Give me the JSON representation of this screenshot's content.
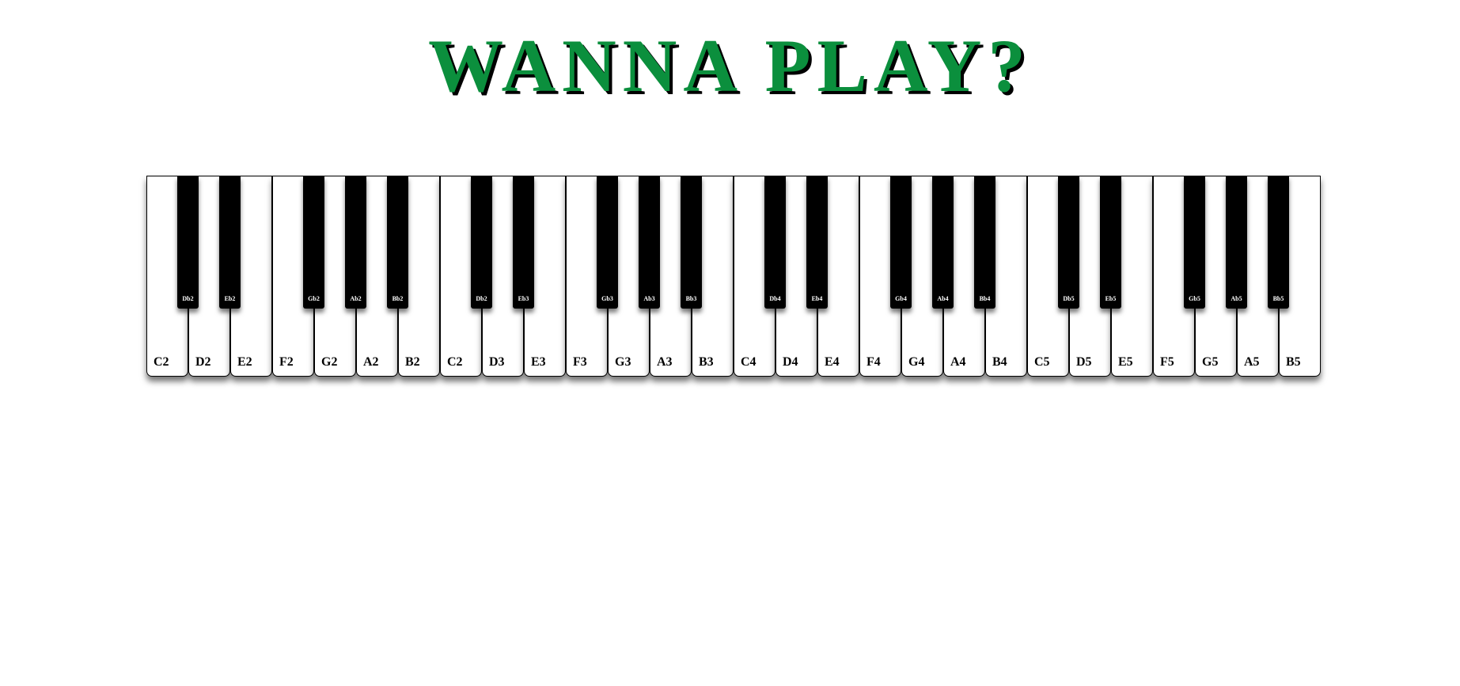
{
  "page": {
    "title": "WANNA PLAY?",
    "title_color": "#0b8f3d"
  },
  "piano": {
    "white_keys": [
      {
        "label": "C2"
      },
      {
        "label": "D2"
      },
      {
        "label": "E2"
      },
      {
        "label": "F2"
      },
      {
        "label": "G2"
      },
      {
        "label": "A2"
      },
      {
        "label": "B2"
      },
      {
        "label": "C2"
      },
      {
        "label": "D3"
      },
      {
        "label": "E3"
      },
      {
        "label": "F3"
      },
      {
        "label": "G3"
      },
      {
        "label": "A3"
      },
      {
        "label": "B3"
      },
      {
        "label": "C4"
      },
      {
        "label": "D4"
      },
      {
        "label": "E4"
      },
      {
        "label": "F4"
      },
      {
        "label": "G4"
      },
      {
        "label": "A4"
      },
      {
        "label": "B4"
      },
      {
        "label": "C5"
      },
      {
        "label": "D5"
      },
      {
        "label": "E5"
      },
      {
        "label": "F5"
      },
      {
        "label": "G5"
      },
      {
        "label": "A5"
      },
      {
        "label": "B5"
      }
    ],
    "black_keys": [
      {
        "label": "Db2"
      },
      {
        "label": "Eb2"
      },
      {
        "label": "Gb2"
      },
      {
        "label": "Ab2"
      },
      {
        "label": "Bb2"
      },
      {
        "label": "Db2"
      },
      {
        "label": "Eb3"
      },
      {
        "label": "Gb3"
      },
      {
        "label": "Ab3"
      },
      {
        "label": "Bb3"
      },
      {
        "label": "Db4"
      },
      {
        "label": "Eb4"
      },
      {
        "label": "Gb4"
      },
      {
        "label": "Ab4"
      },
      {
        "label": "Bb4"
      },
      {
        "label": "Db5"
      },
      {
        "label": "Eb5"
      },
      {
        "label": "Gb5"
      },
      {
        "label": "Ab5"
      },
      {
        "label": "Bb5"
      }
    ]
  }
}
